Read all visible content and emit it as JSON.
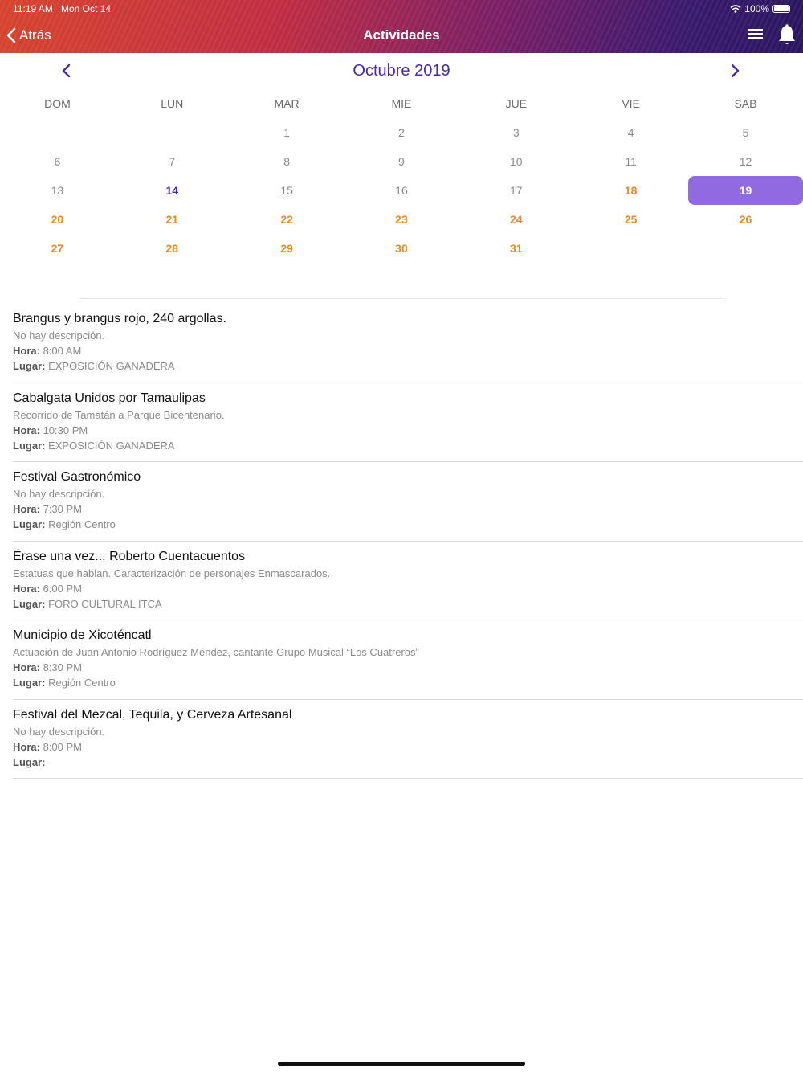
{
  "status": {
    "time": "11:19 AM",
    "date": "Mon Oct 14",
    "battery": "100%"
  },
  "nav": {
    "back_label": "Atrás",
    "title": "Actividades"
  },
  "calendar": {
    "month_title": "Octubre 2019",
    "weekdays": [
      "DOM",
      "LUN",
      "MAR",
      "MIE",
      "JUE",
      "VIE",
      "SAB"
    ],
    "weeks": [
      [
        {
          "d": "",
          "s": "empty"
        },
        {
          "d": "",
          "s": "empty"
        },
        {
          "d": "1",
          "s": "normal"
        },
        {
          "d": "2",
          "s": "normal"
        },
        {
          "d": "3",
          "s": "normal"
        },
        {
          "d": "4",
          "s": "normal"
        },
        {
          "d": "5",
          "s": "normal"
        }
      ],
      [
        {
          "d": "6",
          "s": "normal"
        },
        {
          "d": "7",
          "s": "normal"
        },
        {
          "d": "8",
          "s": "normal"
        },
        {
          "d": "9",
          "s": "normal"
        },
        {
          "d": "10",
          "s": "normal"
        },
        {
          "d": "11",
          "s": "normal"
        },
        {
          "d": "12",
          "s": "normal"
        }
      ],
      [
        {
          "d": "13",
          "s": "normal"
        },
        {
          "d": "14",
          "s": "today"
        },
        {
          "d": "15",
          "s": "normal"
        },
        {
          "d": "16",
          "s": "normal"
        },
        {
          "d": "17",
          "s": "normal"
        },
        {
          "d": "18",
          "s": "event"
        },
        {
          "d": "19",
          "s": "selected"
        }
      ],
      [
        {
          "d": "20",
          "s": "event"
        },
        {
          "d": "21",
          "s": "event"
        },
        {
          "d": "22",
          "s": "event"
        },
        {
          "d": "23",
          "s": "event"
        },
        {
          "d": "24",
          "s": "event"
        },
        {
          "d": "25",
          "s": "event"
        },
        {
          "d": "26",
          "s": "event"
        }
      ],
      [
        {
          "d": "27",
          "s": "event"
        },
        {
          "d": "28",
          "s": "event"
        },
        {
          "d": "29",
          "s": "event"
        },
        {
          "d": "30",
          "s": "event"
        },
        {
          "d": "31",
          "s": "event"
        },
        {
          "d": "",
          "s": "empty"
        },
        {
          "d": "",
          "s": "empty"
        }
      ]
    ]
  },
  "labels": {
    "hora": "Hora:",
    "lugar": "Lugar:"
  },
  "events": [
    {
      "title": "Brangus y brangus rojo, 240 argollas.",
      "description": "No hay descripción.",
      "hora": "8:00 AM",
      "lugar": "EXPOSICIÓN GANADERA"
    },
    {
      "title": "Cabalgata Unidos por Tamaulipas",
      "description": "Recorrido de Tamatán a Parque Bicentenario.",
      "hora": "10:30 PM",
      "lugar": "EXPOSICIÓN GANADERA"
    },
    {
      "title": "Festival Gastronómico",
      "description": "No hay descripción.",
      "hora": "7:30 PM",
      "lugar": "Región Centro"
    },
    {
      "title": "Érase una vez... Roberto Cuentacuentos",
      "description": "Estatuas que hablan. Caracterización de personajes Enmascarados.",
      "hora": "6:00 PM",
      "lugar": "FORO CULTURAL ITCA"
    },
    {
      "title": "Municipio de Xicoténcatl",
      "description": "Actuación de Juan Antonio Rodríguez Méndez, cantante Grupo Musical “Los Cuatreros”",
      "hora": "8:30 PM",
      "lugar": "Región Centro"
    },
    {
      "title": "Festival del Mezcal, Tequila, y Cerveza Artesanal",
      "description": "No hay descripción.",
      "hora": "8:00 PM",
      "lugar": "-"
    }
  ],
  "colors": {
    "accent": "#4a2aa8",
    "event_day": "#e88a22",
    "selected_bg": "#9169e0"
  }
}
